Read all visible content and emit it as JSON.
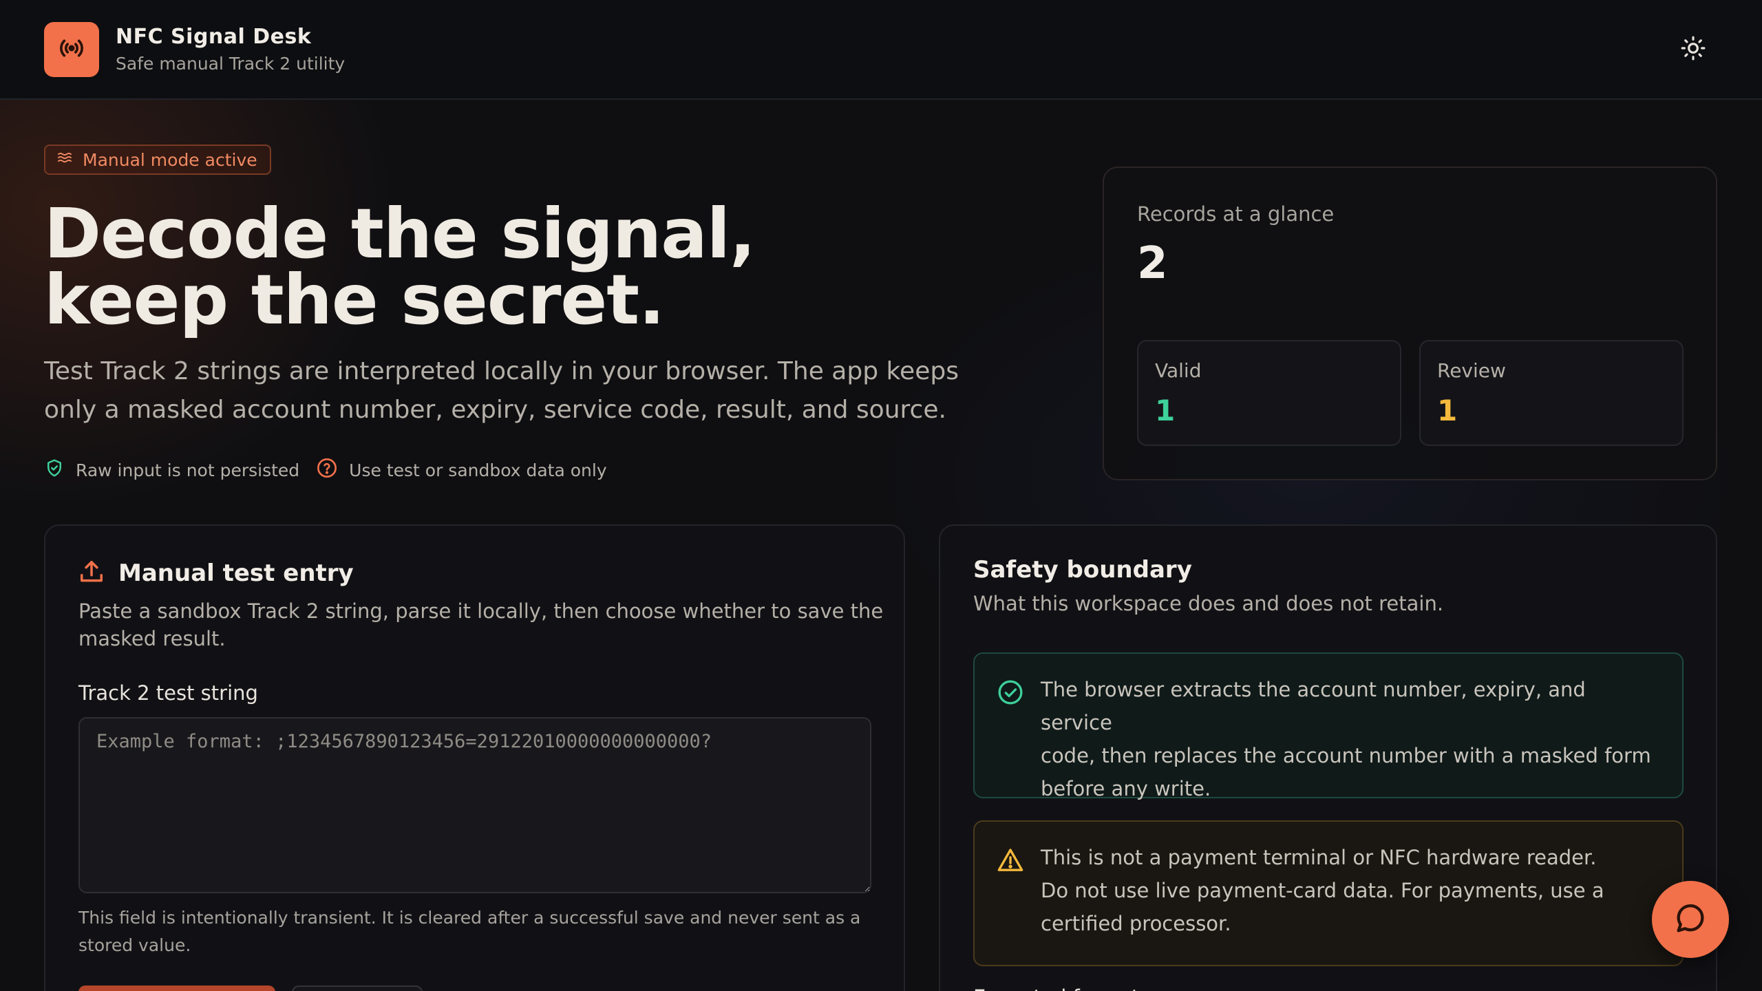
{
  "header": {
    "app_title": "NFC Signal Desk",
    "app_subtitle": "Safe manual Track 2 utility",
    "logo_icon": "broadcast-icon",
    "theme_toggle_icon": "sun-icon"
  },
  "hero": {
    "mode_badge": "Manual mode active",
    "headline_line1": "Decode the signal,",
    "headline_line2": "keep the secret.",
    "lead_line1": "Test Track 2 strings are interpreted locally in your browser. The app keeps",
    "lead_line2": "only a masked account number, expiry, service code, result, and source.",
    "chips": [
      {
        "label": "Raw input is not persisted",
        "icon": "shield-check-icon"
      },
      {
        "label": "Use test or sandbox data only",
        "icon": "help-circle-icon"
      }
    ]
  },
  "records": {
    "label": "Records at a glance",
    "total": "2",
    "valid_label": "Valid",
    "valid_count": "1",
    "review_label": "Review",
    "review_count": "1"
  },
  "manual_entry": {
    "title": "Manual test entry",
    "description_line1": "Paste a sandbox Track 2 string, parse it locally, then choose whether to save the",
    "description_line2": "masked result.",
    "field_label": "Track 2 test string",
    "field_placeholder": "Example format: ;1234567890123456=29122010000000000000?",
    "field_value": "",
    "help_line1": "This field is intentionally transient. It is cleared after a successful save and never sent as a",
    "help_line2": "stored value."
  },
  "safety": {
    "title": "Safety boundary",
    "subtitle": "What this workspace does and does not retain.",
    "note_ok_lines": [
      "The browser extracts the account number, expiry, and service",
      "code, then replaces the account number with a masked form",
      "before any write."
    ],
    "note_warn_lines": [
      "This is not a payment terminal or NFC hardware reader.",
      "Do not use live payment-card data. For payments, use a",
      "certified processor."
    ],
    "formats_label": "Expected format"
  },
  "colors": {
    "accent": "#f2714a",
    "valid": "#3ecf9a",
    "review": "#f5b93c"
  }
}
